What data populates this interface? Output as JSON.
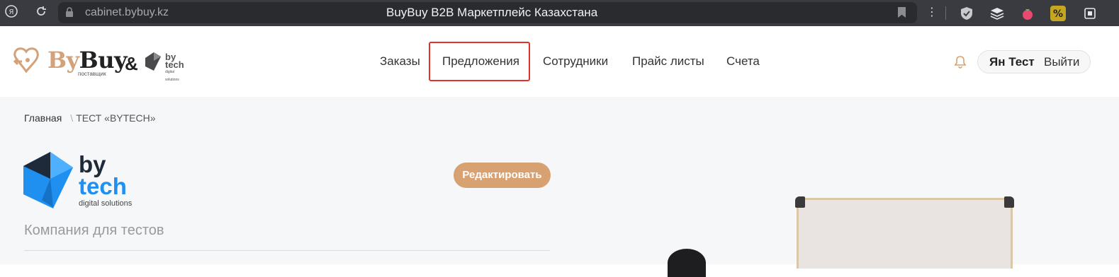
{
  "browser": {
    "url": "cabinet.bybuy.kz",
    "title": "BuyBuy B2B Маркетплейс Казахстана"
  },
  "header": {
    "logo": {
      "brand_by": "By",
      "brand_buy": "Buy",
      "brand_sub": "поставщик",
      "ampersand": "&",
      "partner_line1": "by",
      "partner_line2": "tech",
      "partner_sub": "digital solutions"
    },
    "nav": [
      {
        "label": "Заказы"
      },
      {
        "label": "Предложения",
        "highlighted": true
      },
      {
        "label": "Сотрудники"
      },
      {
        "label": "Прайс листы"
      },
      {
        "label": "Счета"
      }
    ],
    "user": {
      "name": "Ян Тест",
      "logout_label": "Выйти"
    }
  },
  "breadcrumbs": {
    "home": "Главная",
    "separator": "\\",
    "current": "ТЕСТ «BYTECH»"
  },
  "company": {
    "logo_by": "by",
    "logo_tech": "tech",
    "logo_sub": "digital solutions",
    "edit_label": "Редактировать",
    "description": "Компания для тестов"
  },
  "colors": {
    "accent": "#d7a172",
    "highlight_border": "#e0312a",
    "bell": "#d7a172",
    "bytech_blue": "#1f8ff0"
  }
}
